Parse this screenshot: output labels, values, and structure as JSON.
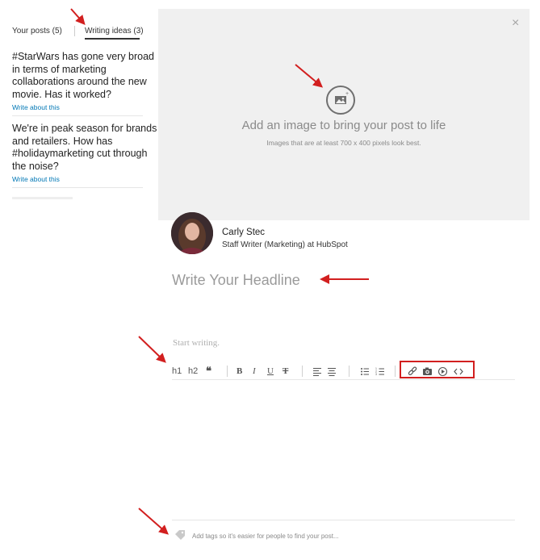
{
  "sidebar": {
    "tabs": [
      {
        "label": "Your posts (5)"
      },
      {
        "label": "Writing ideas (3)"
      }
    ],
    "ideas": [
      {
        "text": "#StarWars has gone very broad in terms of marketing collaborations around the new movie. Has it worked?",
        "link": "Write about this"
      },
      {
        "text": "We're in peak season for brands and retailers. How has #holidaymarketing cut through the noise?",
        "link": "Write about this"
      }
    ]
  },
  "image_upload": {
    "title": "Add an image to bring your post to life",
    "subtitle": "Images that are at least 700 x 400 pixels look best.",
    "close": "×"
  },
  "author": {
    "name": "Carly Stec",
    "title": "Staff Writer (Marketing) at HubSpot"
  },
  "editor": {
    "headline_placeholder": "Write Your Headline",
    "body_placeholder": "Start writing.",
    "toolbar": {
      "h1": "h1",
      "h2": "h2",
      "quote": "❝",
      "bold": "B",
      "italic": "I",
      "underline": "U",
      "strike": "T"
    },
    "tags_placeholder": "Add tags so it's easier for people to find your post..."
  },
  "colors": {
    "annotation_red": "#d21f1f",
    "link_blue": "#0077b5",
    "image_area_bg": "#f0f0f0"
  }
}
